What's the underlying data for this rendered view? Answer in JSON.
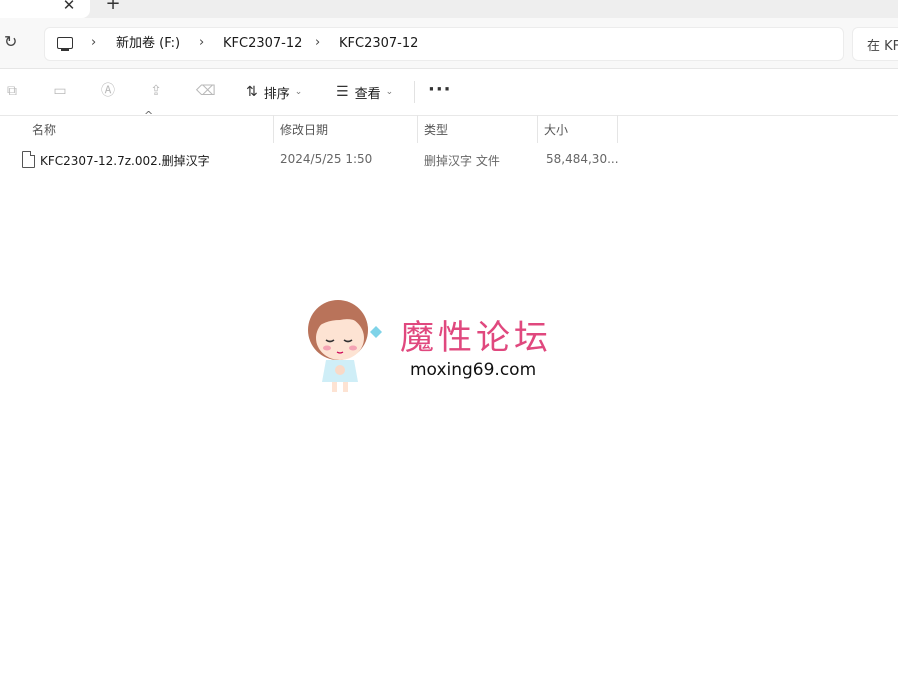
{
  "tabs": {
    "close_glyph": "✕",
    "new_tab_glyph": "+"
  },
  "nav": {
    "refresh_glyph": "↻",
    "breadcrumb": [
      "新加卷 (F:)",
      "KFC2307-12",
      "KFC2307-12"
    ],
    "separator_glyph": "›",
    "search_placeholder": "在 KF"
  },
  "toolbar": {
    "sort_label": "排序",
    "view_label": "查看",
    "more_glyph": "···",
    "icons": [
      "copy-icon",
      "paste-icon",
      "rename-icon",
      "share-icon",
      "delete-icon"
    ]
  },
  "table": {
    "columns": [
      "名称",
      "修改日期",
      "类型",
      "大小"
    ],
    "sort_glyph": "^",
    "rows": [
      {
        "name": "KFC2307-12.7z.002.删掉汉字",
        "date": "2024/5/25 1:50",
        "type": "删掉汉字 文件",
        "size": "58,484,30..."
      }
    ]
  },
  "watermark": {
    "title": "魔性论坛",
    "url": "moxing69.com"
  },
  "colors": {
    "accent": "#e0487e",
    "toolbar_disabled": "#b9b9b9"
  }
}
